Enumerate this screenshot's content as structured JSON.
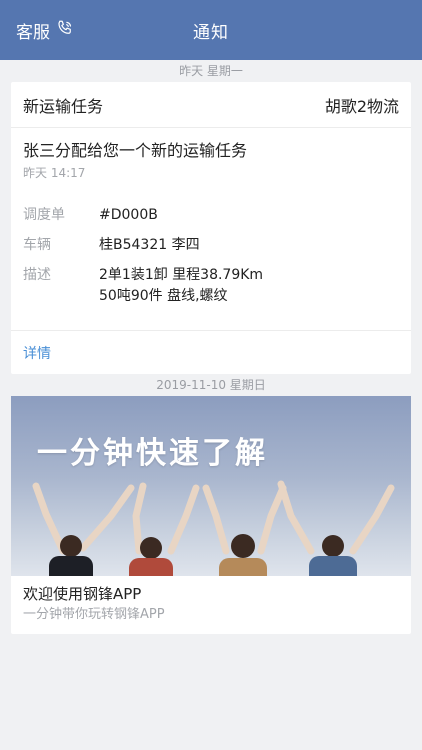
{
  "navbar": {
    "left_label": "客服",
    "left_icon": "phone-icon",
    "title": "通知",
    "background": "#5576b0"
  },
  "feed": {
    "separator_1": "昨天 星期一",
    "task_card": {
      "type": "新运输任务",
      "company": "胡歌2物流",
      "title": "张三分配给您一个新的运输任务",
      "time": "昨天 14:17",
      "rows": [
        {
          "key": "调度单",
          "value": "#D000B"
        },
        {
          "key": "车辆",
          "value": "桂B54321 李四"
        },
        {
          "key": "描述",
          "value": "2单1装1卸 里程38.79Km",
          "value2": "50吨90件 盘线,螺纹"
        }
      ],
      "detail_link": "详情",
      "link_color": "#4a8fd6"
    },
    "separator_2": "2019-11-10 星期日",
    "promo_card": {
      "banner_text": "一分钟快速了解",
      "title": "欢迎使用钢锋APP",
      "subtitle": "一分钟带你玩转钢锋APP"
    }
  }
}
